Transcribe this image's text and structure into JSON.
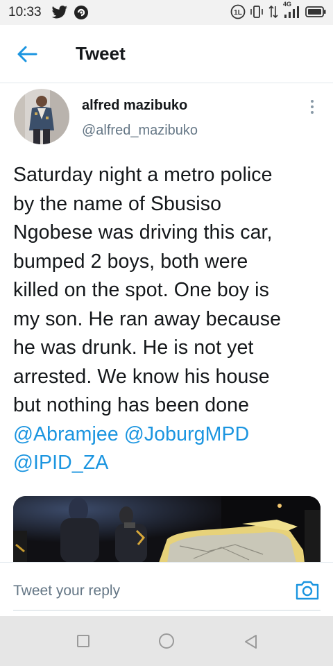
{
  "status_bar": {
    "time": "10:33",
    "network": "4G",
    "icons": [
      "twitter-bird-icon",
      "app-notification-icon",
      "data-icon",
      "vibrate-icon",
      "data-transfer-icon",
      "signal-icon",
      "battery-icon"
    ]
  },
  "header": {
    "title": "Tweet",
    "back_icon": "arrow-left-icon"
  },
  "tweet": {
    "author_name": "alfred mazibuko",
    "author_handle": "@alfred_mazibuko",
    "text_lines": [
      "Saturday night a metro police",
      "by the name of Sbusiso",
      "Ngobese was driving this car,",
      "bumped 2 boys, both were",
      "killed on the spot. One boy is",
      "my son. He ran away because",
      "he was drunk. He is not yet",
      "arrested. We know his house",
      "but nothing has been done"
    ],
    "mentions": [
      "@Abramjee",
      "@JoburgMPD",
      "@IPID_ZA"
    ]
  },
  "reply": {
    "placeholder": "Tweet your reply",
    "camera_icon": "camera-icon"
  },
  "nav": {
    "icons": [
      "recent-apps-icon",
      "home-icon",
      "back-icon"
    ]
  },
  "colors": {
    "accent": "#1b95e0",
    "text": "#14171a",
    "secondary": "#657786"
  }
}
